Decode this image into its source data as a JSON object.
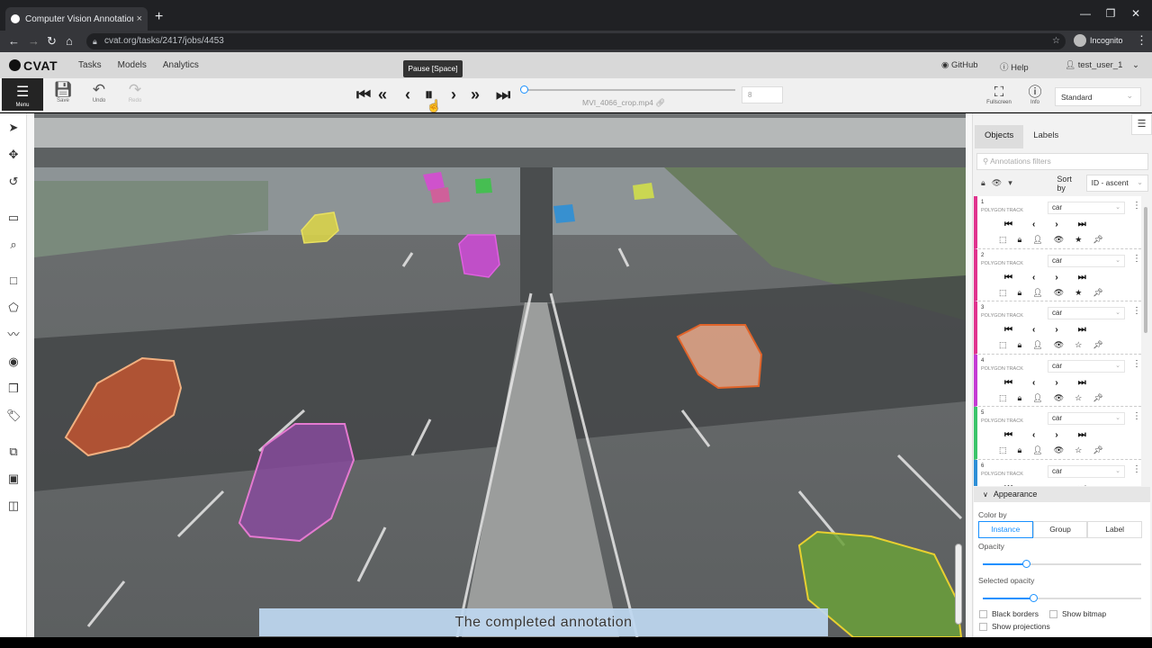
{
  "browser": {
    "tab_title": "Computer Vision Annotation Too",
    "tab_close": "×",
    "new_tab": "+",
    "url": "cvat.org/tasks/2417/jobs/4453",
    "incognito": "Incognito"
  },
  "header": {
    "logo": "CVAT",
    "nav": [
      "Tasks",
      "Models",
      "Analytics"
    ],
    "github": "GitHub",
    "help": "Help",
    "user": "test_user_1"
  },
  "toolbar": {
    "menu_label": "Menu",
    "save_label": "Save",
    "undo_label": "Undo",
    "redo_label": "Redo",
    "tooltip": "Pause [Space]",
    "filename": "MVI_4066_crop.mp4",
    "frame_number": "8",
    "frame_progress": 0.0,
    "fullscreen_label": "Fullscreen",
    "info_label": "Info",
    "workspace": "Standard"
  },
  "left_tools": [
    "cursor-icon",
    "move-icon",
    "rotate-icon",
    "fit-icon",
    "zoom-region-icon",
    "rectangle-icon",
    "polygon-icon",
    "polyline-icon",
    "points-icon",
    "cuboid-icon",
    "tag-icon",
    "merge-icon",
    "group-icon",
    "split-icon"
  ],
  "sidebar": {
    "tabs": [
      "Objects",
      "Labels"
    ],
    "filter_placeholder": "Annotations filters",
    "sort_label": "Sort by",
    "sort_value": "ID - ascent",
    "objects": [
      {
        "id": "1",
        "type": "POLYGON TRACK",
        "label": "car",
        "color": "#e0338e",
        "starred": true
      },
      {
        "id": "2",
        "type": "POLYGON TRACK",
        "label": "car",
        "color": "#e0338e",
        "starred": true
      },
      {
        "id": "3",
        "type": "POLYGON TRACK",
        "label": "car",
        "color": "#e0338e",
        "starred": false
      },
      {
        "id": "4",
        "type": "POLYGON TRACK",
        "label": "car",
        "color": "#c43bd4",
        "starred": false
      },
      {
        "id": "5",
        "type": "POLYGON TRACK",
        "label": "car",
        "color": "#3bc46a",
        "starred": false
      },
      {
        "id": "6",
        "type": "POLYGON TRACK",
        "label": "car",
        "color": "#2e8fd6",
        "starred": false
      }
    ],
    "appearance": {
      "title": "Appearance",
      "color_by_label": "Color by",
      "color_by_options": [
        "Instance",
        "Group",
        "Label"
      ],
      "color_by_selected": "Instance",
      "opacity_label": "Opacity",
      "opacity_value": 0.27,
      "selected_opacity_label": "Selected opacity",
      "selected_opacity_value": 0.32,
      "black_borders": "Black borders",
      "show_bitmap": "Show bitmap",
      "show_projections": "Show projections"
    }
  },
  "caption": "The completed annotation"
}
